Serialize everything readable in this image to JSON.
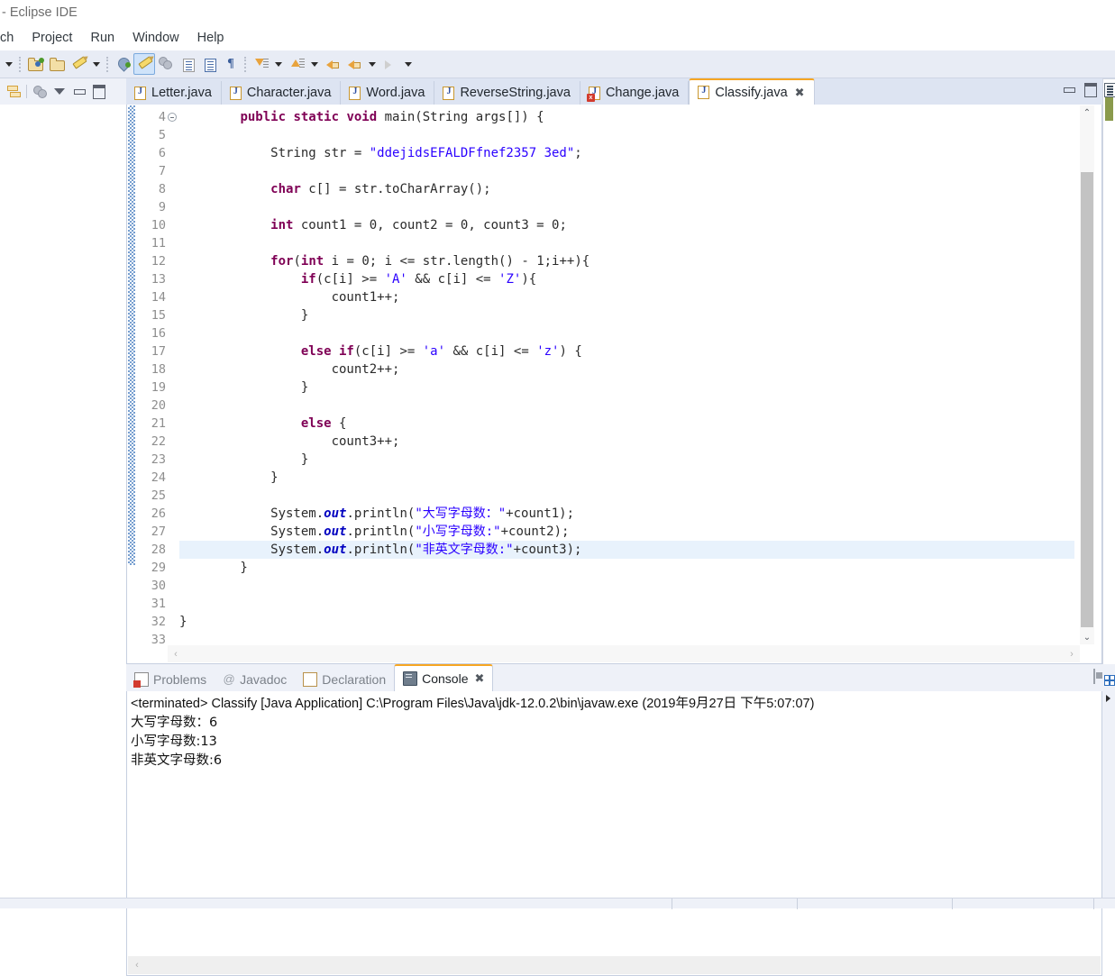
{
  "window": {
    "title": "- Eclipse IDE"
  },
  "menubar": {
    "items": [
      {
        "label": "ch"
      },
      {
        "label": "Project"
      },
      {
        "label": "Run"
      },
      {
        "label": "Window"
      },
      {
        "label": "Help"
      }
    ]
  },
  "toolbar": {
    "icons": [
      "dropdown-arrow",
      "separator",
      "open-project-icon",
      "open-type-icon",
      "edit-icon",
      "dropdown-arrow",
      "separator",
      "debug-icon",
      "run-icon-active",
      "run-external-tools-icon",
      "new-java-class-icon",
      "open-task-icon",
      "pilcrow-icon",
      "separator",
      "next-annotation-icon",
      "dropdown-arrow",
      "previous-annotation-icon",
      "dropdown-arrow",
      "last-edit-location-icon",
      "back-icon",
      "dropdown-arrow",
      "forward-icon",
      "dropdown-arrow"
    ]
  },
  "explorer_toolbar": {
    "icons": [
      "link-with-editor-icon",
      "focus-on-active-task-icon",
      "view-menu-icon",
      "minimize-icon",
      "maximize-icon"
    ]
  },
  "editor": {
    "tabs": [
      {
        "label": "Letter.java",
        "icon": "java-file-icon",
        "selected": false,
        "error": false,
        "closeable": false
      },
      {
        "label": "Character.java",
        "icon": "java-file-icon",
        "selected": false,
        "error": false,
        "closeable": false
      },
      {
        "label": "Word.java",
        "icon": "java-file-icon",
        "selected": false,
        "error": false,
        "closeable": false
      },
      {
        "label": "ReverseString.java",
        "icon": "java-file-icon",
        "selected": false,
        "error": false,
        "closeable": false
      },
      {
        "label": "Change.java",
        "icon": "java-file-error-icon",
        "selected": false,
        "error": true,
        "closeable": false
      },
      {
        "label": "Classify.java",
        "icon": "java-file-icon",
        "selected": true,
        "error": false,
        "closeable": true
      }
    ],
    "tab_close_glyph": "✖",
    "stack_controls": [
      "minimize-icon",
      "maximize-icon"
    ],
    "current_line": 28,
    "first_visible_line": 4,
    "last_visible_line": 33,
    "lines": [
      {
        "n": 4,
        "fold": true,
        "tokens": [
          {
            "t": "        ",
            "c": "pln"
          },
          {
            "t": "public static void ",
            "c": "kw"
          },
          {
            "t": "main(String args[]) {",
            "c": "pln"
          }
        ]
      },
      {
        "n": 5,
        "fold": false,
        "tokens": [
          {
            "t": "",
            "c": "pln"
          }
        ]
      },
      {
        "n": 6,
        "fold": false,
        "tokens": [
          {
            "t": "            String str = ",
            "c": "pln"
          },
          {
            "t": "\"ddejidsEFALDFfnef2357 3ed\"",
            "c": "str"
          },
          {
            "t": ";",
            "c": "pln"
          }
        ]
      },
      {
        "n": 7,
        "fold": false,
        "tokens": [
          {
            "t": "",
            "c": "pln"
          }
        ]
      },
      {
        "n": 8,
        "fold": false,
        "tokens": [
          {
            "t": "            ",
            "c": "pln"
          },
          {
            "t": "char",
            "c": "kw"
          },
          {
            "t": " c[] = str.toCharArray();",
            "c": "pln"
          }
        ]
      },
      {
        "n": 9,
        "fold": false,
        "tokens": [
          {
            "t": "",
            "c": "pln"
          }
        ]
      },
      {
        "n": 10,
        "fold": false,
        "tokens": [
          {
            "t": "            ",
            "c": "pln"
          },
          {
            "t": "int",
            "c": "kw"
          },
          {
            "t": " count1 = 0, count2 = 0, count3 = 0;",
            "c": "pln"
          }
        ]
      },
      {
        "n": 11,
        "fold": false,
        "tokens": [
          {
            "t": "",
            "c": "pln"
          }
        ]
      },
      {
        "n": 12,
        "fold": false,
        "tokens": [
          {
            "t": "            ",
            "c": "pln"
          },
          {
            "t": "for",
            "c": "kw"
          },
          {
            "t": "(",
            "c": "pln"
          },
          {
            "t": "int",
            "c": "kw"
          },
          {
            "t": " i = 0; i <= str.length() - 1;i++){",
            "c": "pln"
          }
        ]
      },
      {
        "n": 13,
        "fold": false,
        "tokens": [
          {
            "t": "                ",
            "c": "pln"
          },
          {
            "t": "if",
            "c": "kw"
          },
          {
            "t": "(c[i] >= ",
            "c": "pln"
          },
          {
            "t": "'A'",
            "c": "str"
          },
          {
            "t": " && c[i] <= ",
            "c": "pln"
          },
          {
            "t": "'Z'",
            "c": "str"
          },
          {
            "t": "){",
            "c": "pln"
          }
        ]
      },
      {
        "n": 14,
        "fold": false,
        "tokens": [
          {
            "t": "                    count1++;",
            "c": "pln"
          }
        ]
      },
      {
        "n": 15,
        "fold": false,
        "tokens": [
          {
            "t": "                }",
            "c": "pln"
          }
        ]
      },
      {
        "n": 16,
        "fold": false,
        "tokens": [
          {
            "t": "",
            "c": "pln"
          }
        ]
      },
      {
        "n": 17,
        "fold": false,
        "tokens": [
          {
            "t": "                ",
            "c": "pln"
          },
          {
            "t": "else if",
            "c": "kw"
          },
          {
            "t": "(c[i] >= ",
            "c": "pln"
          },
          {
            "t": "'a'",
            "c": "str"
          },
          {
            "t": " && c[i] <= ",
            "c": "pln"
          },
          {
            "t": "'z'",
            "c": "str"
          },
          {
            "t": ") {",
            "c": "pln"
          }
        ]
      },
      {
        "n": 18,
        "fold": false,
        "tokens": [
          {
            "t": "                    count2++;",
            "c": "pln"
          }
        ]
      },
      {
        "n": 19,
        "fold": false,
        "tokens": [
          {
            "t": "                }",
            "c": "pln"
          }
        ]
      },
      {
        "n": 20,
        "fold": false,
        "tokens": [
          {
            "t": "",
            "c": "pln"
          }
        ]
      },
      {
        "n": 21,
        "fold": false,
        "tokens": [
          {
            "t": "                ",
            "c": "pln"
          },
          {
            "t": "else",
            "c": "kw"
          },
          {
            "t": " {",
            "c": "pln"
          }
        ]
      },
      {
        "n": 22,
        "fold": false,
        "tokens": [
          {
            "t": "                    count3++;",
            "c": "pln"
          }
        ]
      },
      {
        "n": 23,
        "fold": false,
        "tokens": [
          {
            "t": "                }",
            "c": "pln"
          }
        ]
      },
      {
        "n": 24,
        "fold": false,
        "tokens": [
          {
            "t": "            }",
            "c": "pln"
          }
        ]
      },
      {
        "n": 25,
        "fold": false,
        "tokens": [
          {
            "t": "",
            "c": "pln"
          }
        ]
      },
      {
        "n": 26,
        "fold": false,
        "tokens": [
          {
            "t": "            System.",
            "c": "pln"
          },
          {
            "t": "out",
            "c": "fld"
          },
          {
            "t": ".println(",
            "c": "pln"
          },
          {
            "t": "\"大写字母数：\"",
            "c": "str"
          },
          {
            "t": "+count1);",
            "c": "pln"
          }
        ]
      },
      {
        "n": 27,
        "fold": false,
        "tokens": [
          {
            "t": "            System.",
            "c": "pln"
          },
          {
            "t": "out",
            "c": "fld"
          },
          {
            "t": ".println(",
            "c": "pln"
          },
          {
            "t": "\"小写字母数:\"",
            "c": "str"
          },
          {
            "t": "+count2);",
            "c": "pln"
          }
        ]
      },
      {
        "n": 28,
        "fold": false,
        "tokens": [
          {
            "t": "            System.",
            "c": "pln"
          },
          {
            "t": "out",
            "c": "fld"
          },
          {
            "t": ".println(",
            "c": "pln"
          },
          {
            "t": "\"非英文字母数:\"",
            "c": "str"
          },
          {
            "t": "+count3);",
            "c": "pln"
          }
        ]
      },
      {
        "n": 29,
        "fold": false,
        "tokens": [
          {
            "t": "        }",
            "c": "pln"
          }
        ]
      },
      {
        "n": 30,
        "fold": false,
        "tokens": [
          {
            "t": "",
            "c": "pln"
          }
        ]
      },
      {
        "n": 31,
        "fold": false,
        "tokens": [
          {
            "t": "",
            "c": "pln"
          }
        ]
      },
      {
        "n": 32,
        "fold": false,
        "tokens": [
          {
            "t": "}",
            "c": "pln"
          }
        ]
      },
      {
        "n": 33,
        "fold": false,
        "tokens": [
          {
            "t": "",
            "c": "pln"
          }
        ]
      }
    ]
  },
  "bottom_panel": {
    "tabs": [
      {
        "label": "Problems",
        "icon": "problems-icon",
        "selected": false
      },
      {
        "label": "Javadoc",
        "icon": "javadoc-icon",
        "selected": false
      },
      {
        "label": "Declaration",
        "icon": "declaration-icon",
        "selected": false
      },
      {
        "label": "Console",
        "icon": "console-icon",
        "selected": true
      }
    ],
    "tab_close_glyph": "✖",
    "controls": [
      "terminate-icon"
    ]
  },
  "console": {
    "header": "<terminated> Classify [Java Application] C:\\Program Files\\Java\\jdk-12.0.2\\bin\\javaw.exe (2019年9月27日 下午5:07:07)",
    "output": [
      "大写字母数：6",
      "小写字母数:13",
      "非英文字母数:6"
    ]
  },
  "right_sliver": {
    "panels": [
      {
        "name": "outline-view",
        "icon": "outline-icon"
      },
      {
        "name": "task-list-view",
        "icon": "task-list-icon"
      }
    ]
  },
  "colors": {
    "tab_active_top": "#f6a623",
    "keyword": "#7f0055",
    "string": "#2a00ff",
    "field": "#0000c0",
    "current_line_highlight": "#e8f2fc",
    "toolbar_bg": "#e8ecf5",
    "tabbar_bg": "#dde4f2"
  },
  "glyphs": {
    "scroll_up": "⌃",
    "scroll_down": "⌄",
    "scroll_left": "‹",
    "scroll_right": "›",
    "at_sign": "@"
  }
}
